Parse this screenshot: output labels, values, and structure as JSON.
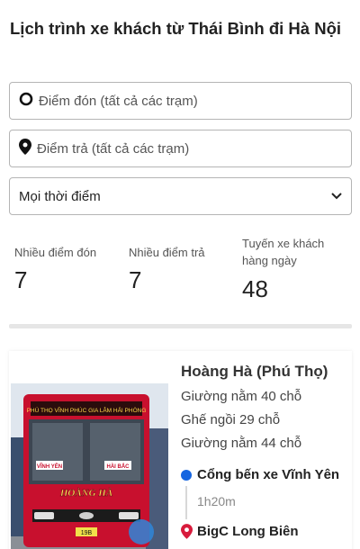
{
  "page": {
    "title": "Lịch trình xe khách từ Thái Bình đi Hà Nội"
  },
  "search": {
    "pickup_placeholder": "Điểm đón (tất cả các trạm)",
    "dropoff_placeholder": "Điểm trả (tất cả các trạm)",
    "time_selected": "Mọi thời điểm"
  },
  "stats": [
    {
      "label": "Nhiều điểm đón",
      "value": "7"
    },
    {
      "label": "Nhiều điểm trả",
      "value": "7"
    },
    {
      "label": "Tuyến xe khách hàng ngày",
      "value": "48"
    }
  ],
  "trip": {
    "operator": "Hoàng Hà (Phú Thọ)",
    "seats": [
      "Giường nằm 40 chỗ",
      "Ghế ngồi 29 chỗ",
      "Giường nằm 44 chỗ"
    ],
    "from_stop": "Cổng bến xe Vĩnh Yên",
    "duration": "1h20m",
    "to_stop": "BigC Long Biên",
    "bus_sign_top": "PHÚ THỌ  VĨNH PHÚC  GIA LÂM  HẢI PHÒNG",
    "bus_sign_left": "VĨNH YÊN",
    "bus_sign_right": "HÀI BẮC",
    "bus_brand": "HOÀNG HÀ",
    "plate": "19B"
  },
  "colors": {
    "accent_blue": "#1565e0",
    "pin_red": "#d81b3c",
    "bus_red": "#c8102e"
  }
}
